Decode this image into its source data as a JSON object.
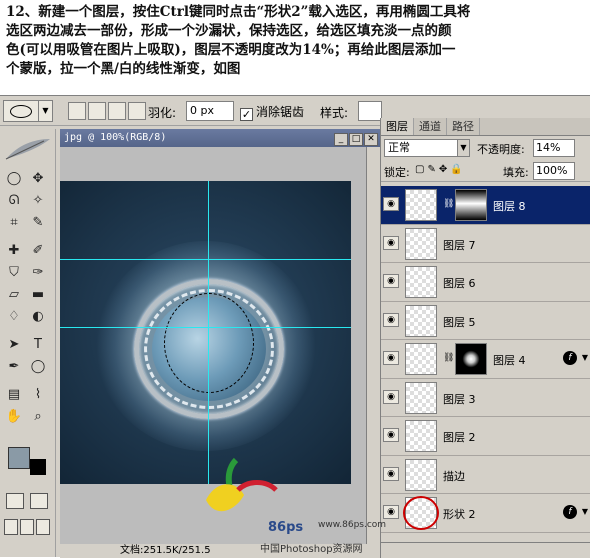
{
  "instruction": {
    "line1": "12、新建一个图层，按住Ctrl键同时点击“形状2”载入选区，再用椭圆工具将",
    "line2": "选区两边减去一部份，形成一个沙漏状，保持选区，给选区填充淡一点的颜",
    "line3": "色(可以用吸管在图片上吸取)，图层不透明度改为14%；再给此图层添加一",
    "line4": "个蒙版，拉一个黑/白的线性渐变，如图"
  },
  "options_bar": {
    "feather_label": "羽化:",
    "feather_value": "0 px",
    "antialias_label": "消除锯齿",
    "antialias_checked": "✓",
    "style_label": "样式:"
  },
  "document": {
    "title": "jpg @ 100%(RGB/8)",
    "status": "文档:251.5K/251.5"
  },
  "layers_panel": {
    "tabs": [
      "图层",
      "通道",
      "路径"
    ],
    "blend_mode": "正常",
    "opacity_label": "不透明度:",
    "opacity_value": "14%",
    "lock_label": "锁定:",
    "fill_label": "填充:",
    "fill_value": "100%",
    "layers": [
      {
        "name": "图层 8",
        "selected": true
      },
      {
        "name": "图层 7"
      },
      {
        "name": "图层 6"
      },
      {
        "name": "图层 5"
      },
      {
        "name": "图层 4"
      },
      {
        "name": "图层 3"
      },
      {
        "name": "图层 2"
      },
      {
        "name": "描边"
      },
      {
        "name": "形状 2"
      }
    ]
  },
  "watermark": {
    "logo_text": "86ps",
    "url": "www.86ps.com",
    "site": "中国Photoshop资源网"
  }
}
